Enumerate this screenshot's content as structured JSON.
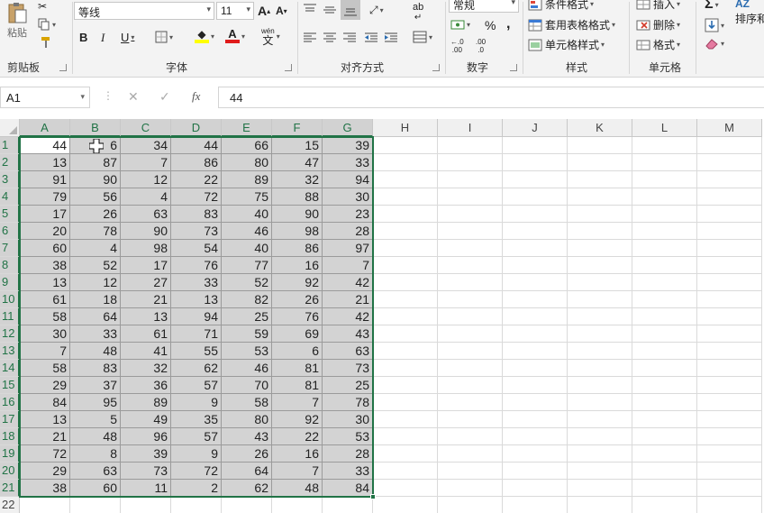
{
  "ribbon": {
    "clipboard": {
      "paste_label": "粘贴",
      "group_label": "剪贴板"
    },
    "font": {
      "name": "等线",
      "size": "11",
      "grow": "A",
      "shrink": "A",
      "bold": "B",
      "italic": "I",
      "underline": "U",
      "font_color_glyph": "A",
      "phonetic_top": "wén",
      "phonetic_bottom": "文",
      "group_label": "字体"
    },
    "alignment": {
      "wrap_glyph": "ab",
      "group_label": "对齐方式"
    },
    "number": {
      "format": "常规",
      "percent": "%",
      "comma": ",",
      "inc_decimal": ".00",
      "dec_decimal": ".0",
      "group_label": "数字"
    },
    "styles": {
      "conditional": "条件格式",
      "table": "套用表格格式",
      "cell_styles": "单元格样式",
      "group_label": "样式"
    },
    "cells": {
      "insert": "插入",
      "delete": "删除",
      "format": "格式",
      "group_label": "单元格"
    },
    "editing": {
      "sum": "Σ",
      "sort_glyph": "AZ",
      "sort": "排序和"
    }
  },
  "formula_bar": {
    "name_box": "A1",
    "cancel": "✕",
    "enter": "✓",
    "fx": "fx",
    "content": "44"
  },
  "sheet": {
    "columns": [
      "A",
      "B",
      "C",
      "D",
      "E",
      "F",
      "G",
      "H",
      "I",
      "J",
      "K",
      "L",
      "M"
    ],
    "rows": [
      "1",
      "2",
      "3",
      "4",
      "5",
      "6",
      "7",
      "8",
      "9",
      "10",
      "11",
      "12",
      "13",
      "14",
      "15",
      "16",
      "17",
      "18",
      "19",
      "20",
      "21",
      "22"
    ],
    "data": [
      [
        "44",
        "6",
        "34",
        "44",
        "66",
        "15",
        "39"
      ],
      [
        "13",
        "87",
        "7",
        "86",
        "80",
        "47",
        "33"
      ],
      [
        "91",
        "90",
        "12",
        "22",
        "89",
        "32",
        "94"
      ],
      [
        "79",
        "56",
        "4",
        "72",
        "75",
        "88",
        "30"
      ],
      [
        "17",
        "26",
        "63",
        "83",
        "40",
        "90",
        "23"
      ],
      [
        "20",
        "78",
        "90",
        "73",
        "46",
        "98",
        "28"
      ],
      [
        "60",
        "4",
        "98",
        "54",
        "40",
        "86",
        "97"
      ],
      [
        "38",
        "52",
        "17",
        "76",
        "77",
        "16",
        "7"
      ],
      [
        "13",
        "12",
        "27",
        "33",
        "52",
        "92",
        "42"
      ],
      [
        "61",
        "18",
        "21",
        "13",
        "82",
        "26",
        "21"
      ],
      [
        "58",
        "64",
        "13",
        "94",
        "25",
        "76",
        "42"
      ],
      [
        "30",
        "33",
        "61",
        "71",
        "59",
        "69",
        "43"
      ],
      [
        "7",
        "48",
        "41",
        "55",
        "53",
        "6",
        "63"
      ],
      [
        "58",
        "83",
        "32",
        "62",
        "46",
        "81",
        "73"
      ],
      [
        "29",
        "37",
        "36",
        "57",
        "70",
        "81",
        "25"
      ],
      [
        "84",
        "95",
        "89",
        "9",
        "58",
        "7",
        "78"
      ],
      [
        "13",
        "5",
        "49",
        "35",
        "80",
        "92",
        "30"
      ],
      [
        "21",
        "48",
        "96",
        "57",
        "43",
        "22",
        "53"
      ],
      [
        "72",
        "8",
        "39",
        "9",
        "26",
        "16",
        "28"
      ],
      [
        "29",
        "63",
        "73",
        "72",
        "64",
        "7",
        "33"
      ],
      [
        "38",
        "60",
        "11",
        "2",
        "62",
        "48",
        "84"
      ]
    ],
    "selection": "A1:G21",
    "active_cell": "A1"
  },
  "colors": {
    "accent": "#217346",
    "selection_fill": "#d3d3d3",
    "header_bg": "#f0f0f0",
    "ribbon_bg": "#f3f3f3"
  }
}
